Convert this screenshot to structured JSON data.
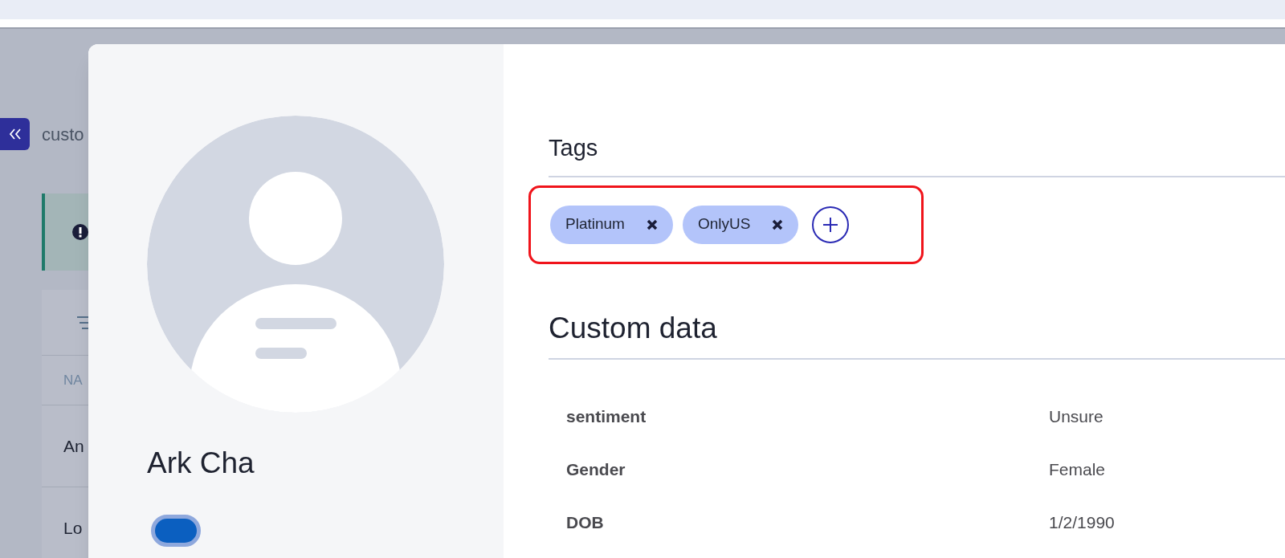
{
  "background": {
    "breadcrumb": "custo",
    "table_header": "NA",
    "rows": [
      "An",
      "Lo"
    ]
  },
  "profile": {
    "name": "Ark Cha"
  },
  "tags": {
    "title": "Tags",
    "items": [
      {
        "label": "Platinum"
      },
      {
        "label": "OnlyUS"
      }
    ],
    "highlighted": true
  },
  "custom_data": {
    "title": "Custom data",
    "rows": [
      {
        "label": "sentiment",
        "value": "Unsure"
      },
      {
        "label": "Gender",
        "value": "Female"
      },
      {
        "label": "DOB",
        "value": "1/2/1990"
      }
    ]
  }
}
